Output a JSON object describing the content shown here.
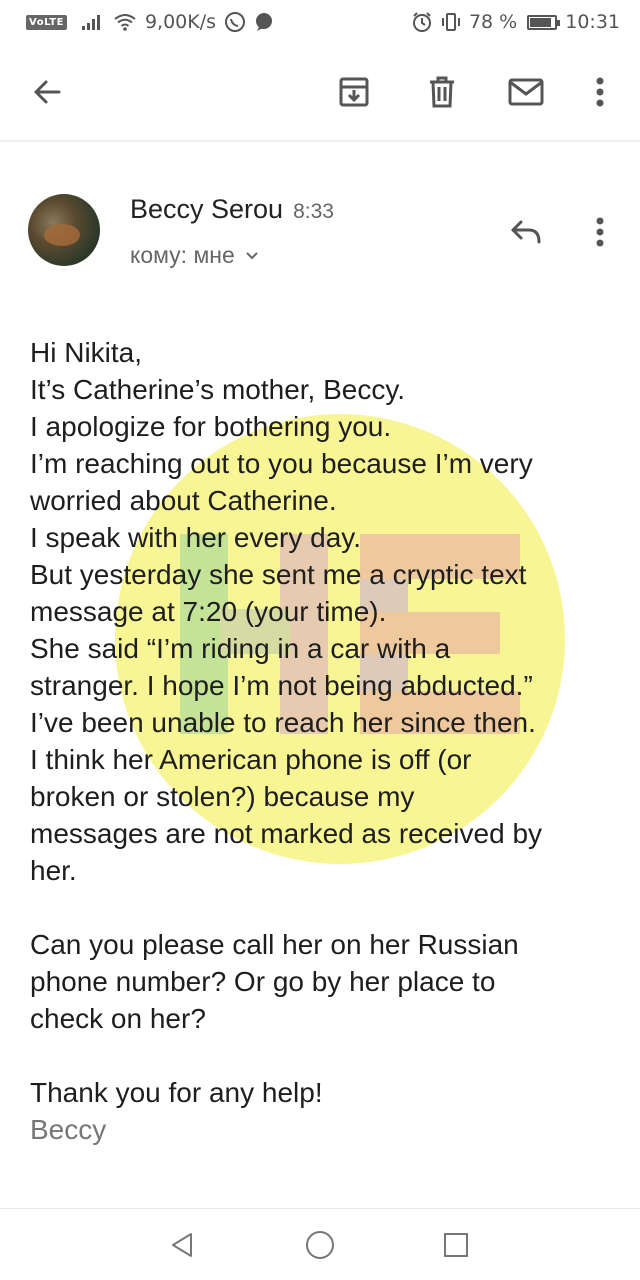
{
  "status_bar": {
    "volte": "VoLTE",
    "speed": "9,00K/s",
    "battery": "78 %",
    "battery_level": 0.78,
    "time": "10:31"
  },
  "toolbar": {
    "icons": [
      "back-arrow-icon",
      "archive-icon",
      "delete-icon",
      "mail-icon",
      "more-vert-icon"
    ]
  },
  "email": {
    "sender": "Beccy Serou",
    "time": "8:33",
    "recipient": "кому: мне",
    "body_lines": [
      "Hi Nikita,",
      "It’s Catherine’s mother, Beccy.",
      "I apologize for bothering you.",
      "I’m reaching out to you because I’m very",
      "worried about Catherine.",
      "I speak with her every day.",
      "But yesterday she sent me a cryptic text",
      "message at 7:20 (your time).",
      "She said “I’m riding in a car with a",
      "stranger. I hope I’m not being abducted.”",
      "I’ve been unable to reach her since then.",
      "I think her American phone is off (or",
      "broken or stolen?) because my",
      "messages are not marked as received by",
      "her."
    ],
    "body_lines_2": [
      "Can you please call her on her Russian",
      "phone number?  Or go by her place to",
      "check on her?"
    ],
    "closing": "Thank you for any help!",
    "signature": "Beccy"
  },
  "watermark": {
    "circle_color": "#f6f27a",
    "letters": "HE"
  },
  "nav_bar": {
    "icons": [
      "nav-back-icon",
      "nav-home-icon",
      "nav-recents-icon"
    ]
  }
}
